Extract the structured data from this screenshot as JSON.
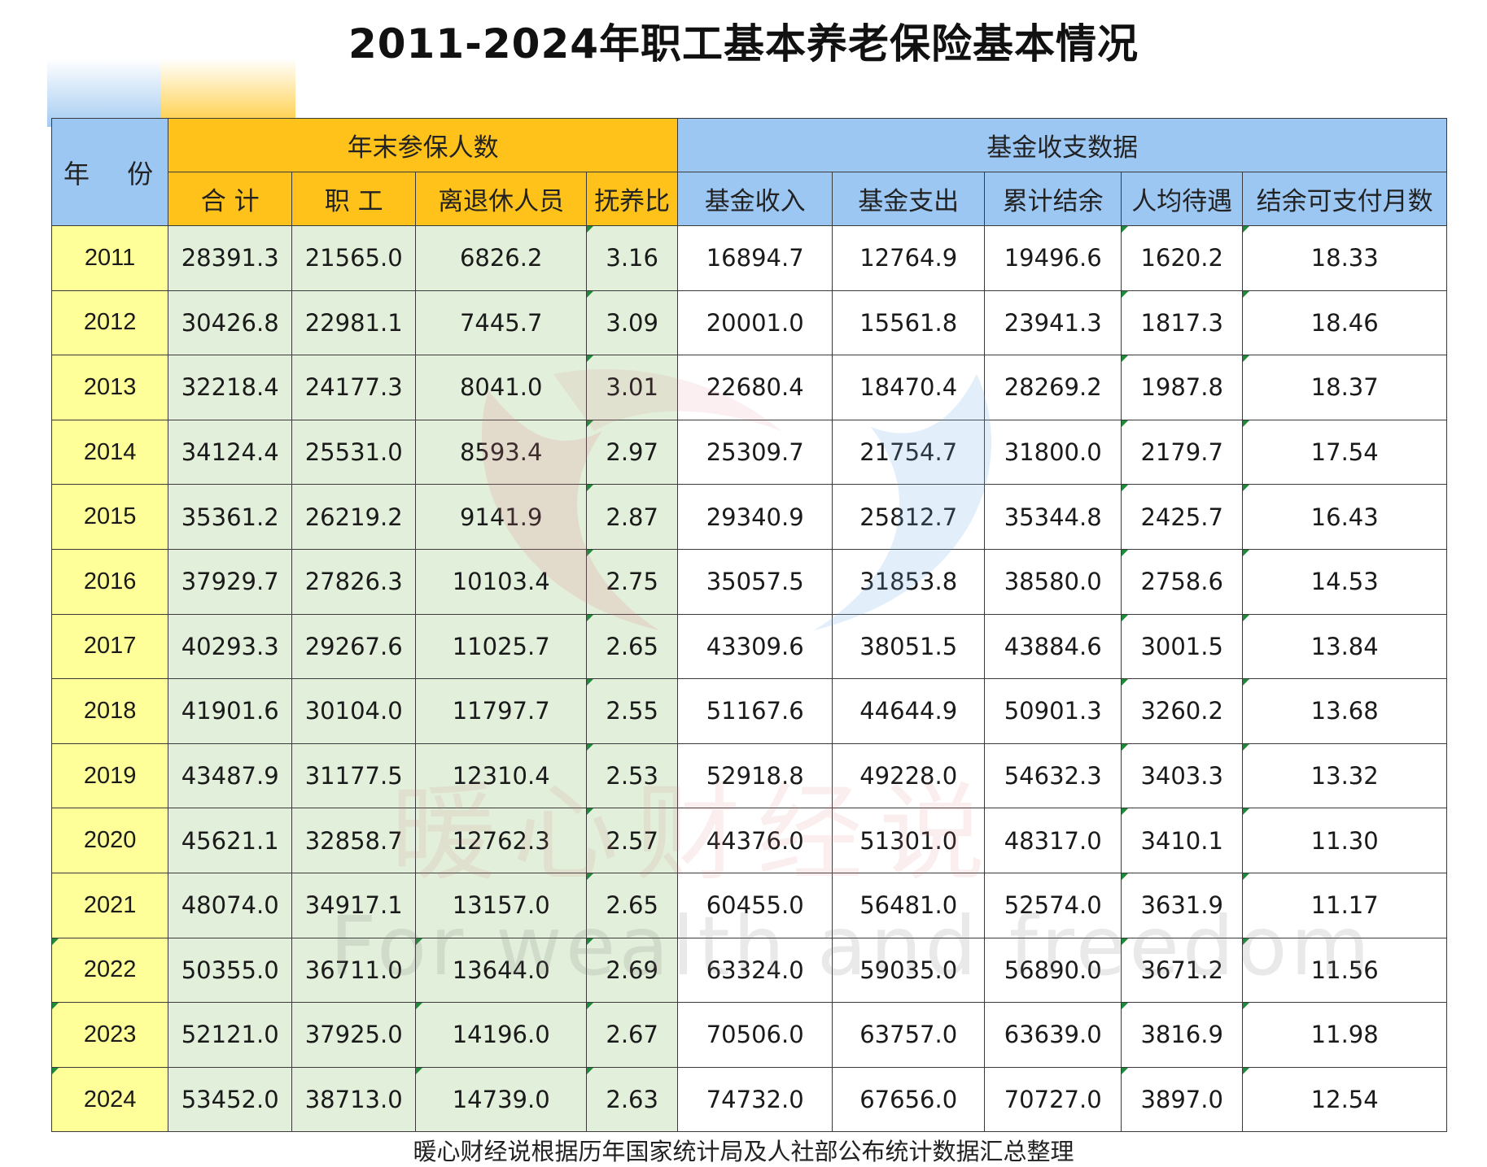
{
  "title": "2011-2024年职工基本养老保险基本情况",
  "header": {
    "year": "年 份",
    "group_enrollment": "年末参保人数",
    "group_fund": "基金收支数据",
    "columns": [
      "合 计",
      "职 工",
      "离退休人员",
      "抚养比",
      "基金收入",
      "基金支出",
      "累计结余",
      "人均待遇",
      "结余可支付月数"
    ]
  },
  "rows": [
    {
      "year": "2011",
      "cells": [
        "28391.3",
        "21565.0",
        "6826.2",
        "3.16",
        "16894.7",
        "12764.9",
        "19496.6",
        "1620.2",
        "18.33"
      ]
    },
    {
      "year": "2012",
      "cells": [
        "30426.8",
        "22981.1",
        "7445.7",
        "3.09",
        "20001.0",
        "15561.8",
        "23941.3",
        "1817.3",
        "18.46"
      ]
    },
    {
      "year": "2013",
      "cells": [
        "32218.4",
        "24177.3",
        "8041.0",
        "3.01",
        "22680.4",
        "18470.4",
        "28269.2",
        "1987.8",
        "18.37"
      ]
    },
    {
      "year": "2014",
      "cells": [
        "34124.4",
        "25531.0",
        "8593.4",
        "2.97",
        "25309.7",
        "21754.7",
        "31800.0",
        "2179.7",
        "17.54"
      ]
    },
    {
      "year": "2015",
      "cells": [
        "35361.2",
        "26219.2",
        "9141.9",
        "2.87",
        "29340.9",
        "25812.7",
        "35344.8",
        "2425.7",
        "16.43"
      ]
    },
    {
      "year": "2016",
      "cells": [
        "37929.7",
        "27826.3",
        "10103.4",
        "2.75",
        "35057.5",
        "31853.8",
        "38580.0",
        "2758.6",
        "14.53"
      ]
    },
    {
      "year": "2017",
      "cells": [
        "40293.3",
        "29267.6",
        "11025.7",
        "2.65",
        "43309.6",
        "38051.5",
        "43884.6",
        "3001.5",
        "13.84"
      ]
    },
    {
      "year": "2018",
      "cells": [
        "41901.6",
        "30104.0",
        "11797.7",
        "2.55",
        "51167.6",
        "44644.9",
        "50901.3",
        "3260.2",
        "13.68"
      ]
    },
    {
      "year": "2019",
      "cells": [
        "43487.9",
        "31177.5",
        "12310.4",
        "2.53",
        "52918.8",
        "49228.0",
        "54632.3",
        "3403.3",
        "13.32"
      ]
    },
    {
      "year": "2020",
      "cells": [
        "45621.1",
        "32858.7",
        "12762.3",
        "2.57",
        "44376.0",
        "51301.0",
        "48317.0",
        "3410.1",
        "11.30"
      ]
    },
    {
      "year": "2021",
      "cells": [
        "48074.0",
        "34917.1",
        "13157.0",
        "2.65",
        "60455.0",
        "56481.0",
        "52574.0",
        "3631.9",
        "11.17"
      ]
    },
    {
      "year": "2022",
      "cells": [
        "50355.0",
        "36711.0",
        "13644.0",
        "2.69",
        "63324.0",
        "59035.0",
        "56890.0",
        "3671.2",
        "11.56"
      ]
    },
    {
      "year": "2023",
      "cells": [
        "52121.0",
        "37925.0",
        "14196.0",
        "2.67",
        "70506.0",
        "63757.0",
        "63639.0",
        "3816.9",
        "11.98"
      ]
    },
    {
      "year": "2024",
      "cells": [
        "53452.0",
        "38713.0",
        "14739.0",
        "2.63",
        "74732.0",
        "67656.0",
        "70727.0",
        "3897.0",
        "12.54"
      ]
    }
  ],
  "footer": "暖心财经说根据历年国家统计局及人社部公布统计数据汇总整理",
  "watermark": {
    "cn": "暖心财经说",
    "en": "For wealth and freedom"
  },
  "colors": {
    "year_column": "#ffff99",
    "enrollment_header": "#ffc21a",
    "fund_header": "#9cc7f3",
    "enrollment_cells": "#e2efda",
    "fund_cells": "#ffffff"
  }
}
